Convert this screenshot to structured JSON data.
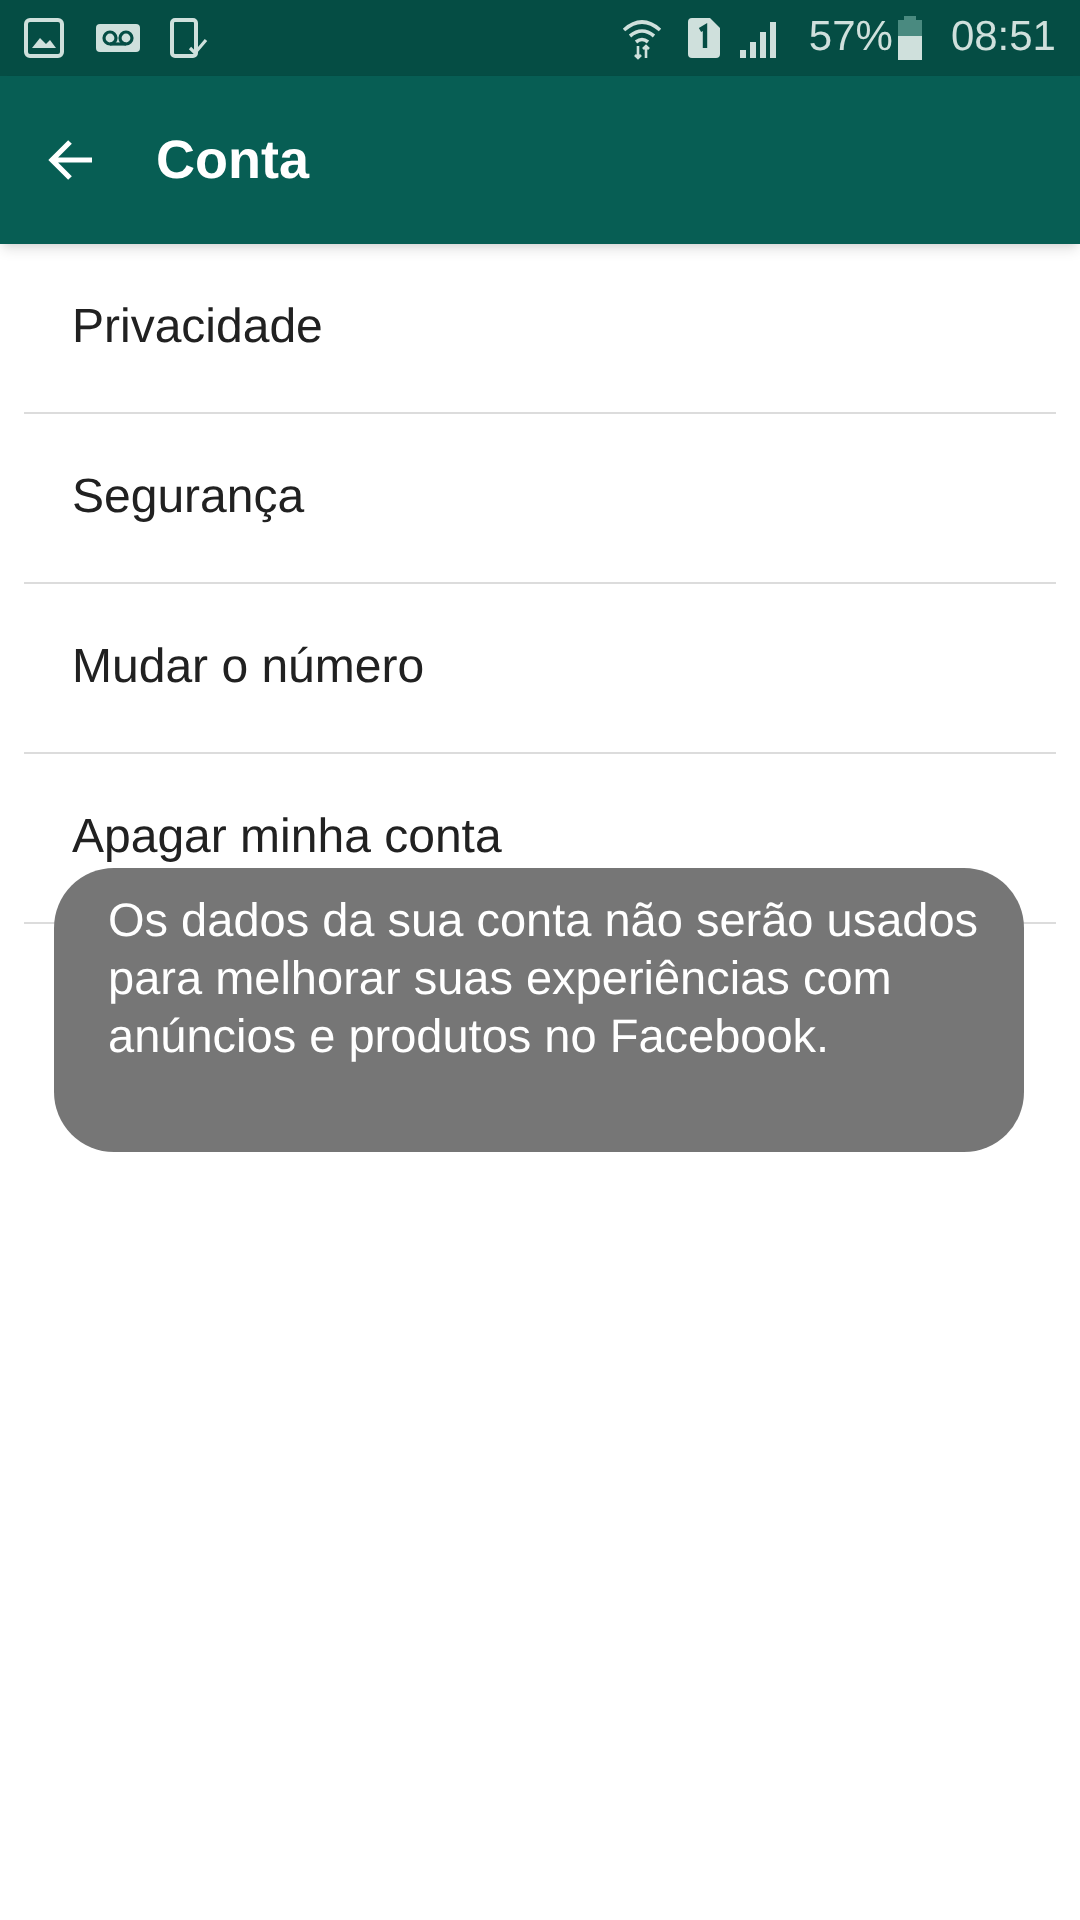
{
  "status_bar": {
    "battery": "57%",
    "time": "08:51"
  },
  "app_bar": {
    "title": "Conta"
  },
  "menu": {
    "items": [
      {
        "label": "Privacidade"
      },
      {
        "label": "Segurança"
      },
      {
        "label": "Mudar o número"
      },
      {
        "label": "Apagar minha conta"
      }
    ]
  },
  "toast": {
    "text": "Os dados da sua conta não serão usados para melhorar suas experiências com anúncios e produtos no Facebook."
  }
}
